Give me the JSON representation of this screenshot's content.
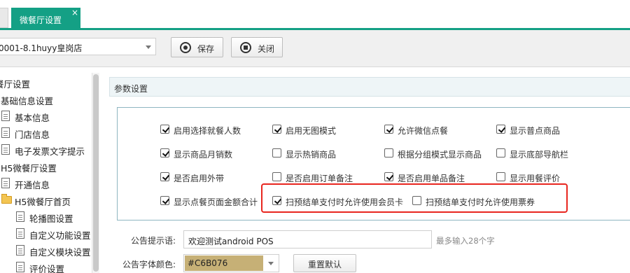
{
  "tabs": {
    "active_label": "微餐厅设置",
    "close_glyph": "×",
    "accent_color": "#14A085"
  },
  "toolbar": {
    "store_value": "0001-8.1huyy皇岗店",
    "save_label": "保存",
    "close_label": "关闭"
  },
  "sidebar": {
    "items": [
      {
        "label": "餐厅设置",
        "icon": "none"
      },
      {
        "label": "基础信息设置",
        "icon": "none"
      },
      {
        "label": "基本信息",
        "icon": "document-icon"
      },
      {
        "label": "门店信息",
        "icon": "document-icon"
      },
      {
        "label": "电子发票文字提示",
        "icon": "document-icon"
      },
      {
        "label": "H5微餐厅设置",
        "icon": "none"
      },
      {
        "label": "开通信息",
        "icon": "document-icon"
      },
      {
        "label": "H5微餐厅首页",
        "icon": "folder-icon"
      },
      {
        "label": "轮播图设置",
        "icon": "document-icon"
      },
      {
        "label": "自定义功能设置",
        "icon": "document-icon"
      },
      {
        "label": "自定义模块设置",
        "icon": "document-icon"
      },
      {
        "label": "评价设置",
        "icon": "document-icon"
      }
    ]
  },
  "params": {
    "title": "参数设置",
    "options": [
      {
        "label": "启用选择就餐人数",
        "checked": true
      },
      {
        "label": "启用无图模式",
        "checked": true
      },
      {
        "label": "允许微信点餐",
        "checked": true
      },
      {
        "label": "显示普点商品",
        "checked": true
      },
      {
        "label": "显示商品月销数",
        "checked": true
      },
      {
        "label": "显示热销商品",
        "checked": false
      },
      {
        "label": "根据分组模式显示商品",
        "checked": false
      },
      {
        "label": "显示底部导航栏",
        "checked": false
      },
      {
        "label": "是否启用外带",
        "checked": true
      },
      {
        "label": "是否启用订单备注",
        "checked": false
      },
      {
        "label": "是否启用单品备注",
        "checked": true
      },
      {
        "label": "显示用餐评价",
        "checked": false
      },
      {
        "label": "显示点餐页面金额合计",
        "checked": true
      },
      {
        "label": "扫预结单支付时允许使用会员卡",
        "checked": true
      },
      {
        "label": "扫预结单支付时允许使用票券",
        "checked": false
      }
    ],
    "highlight_color": "#E8261F"
  },
  "notice": {
    "label": "公告提示语:",
    "value": "欢迎测试android POS",
    "hint": "最多输入28个字"
  },
  "font_color": {
    "label": "公告字体颜色:",
    "value": "#C6B076",
    "swatch": "#C6B076",
    "reset_label": "重置默认"
  }
}
